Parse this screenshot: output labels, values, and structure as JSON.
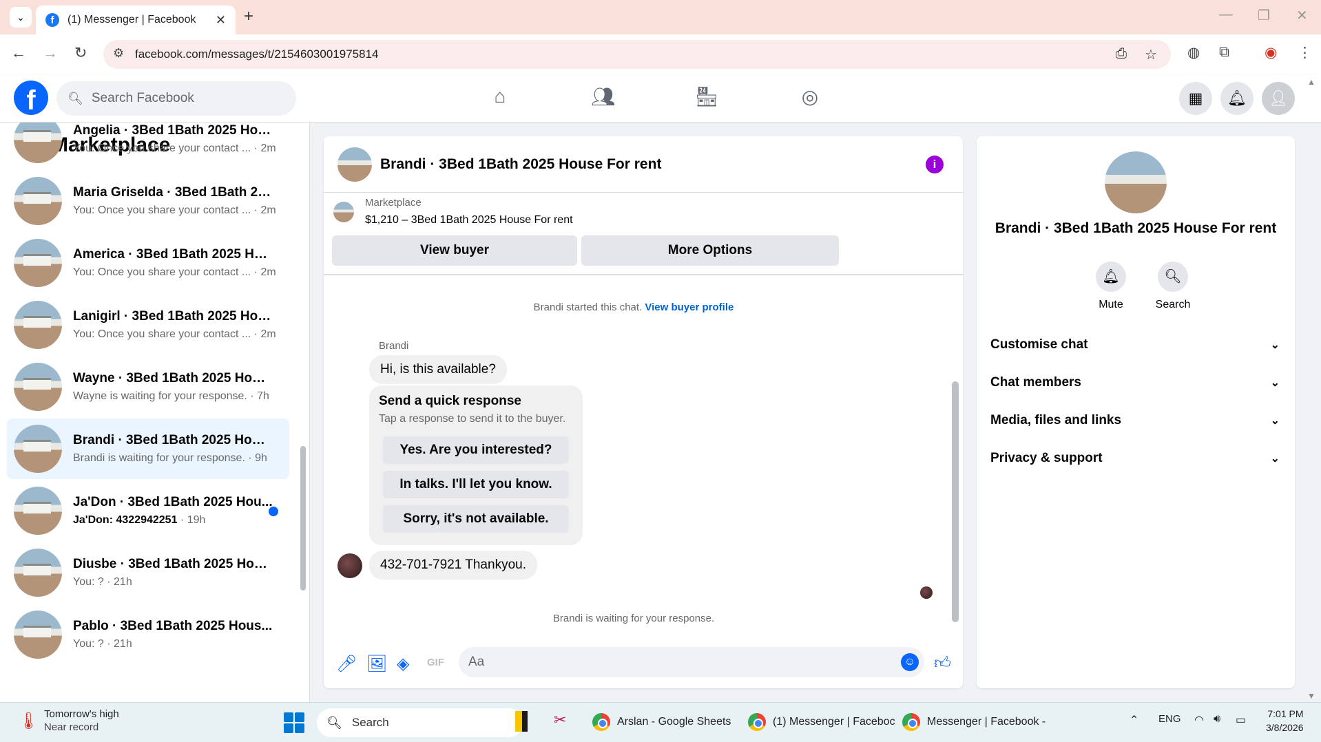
{
  "browser": {
    "tab_title": "(1) Messenger | Facebook",
    "url": "facebook.com/messages/t/2154603001975814"
  },
  "fb_header": {
    "search_placeholder": "Search Facebook"
  },
  "sidebar": {
    "title": "Marketplace",
    "conversations": [
      {
        "name": "Angelia · 3Bed 1Bath 2025 Hous...",
        "preview": "You: Once you share your contact ...",
        "time": "2m",
        "active": false
      },
      {
        "name": "Maria Griselda · 3Bed 1Bath 202...",
        "preview": "You: Once you share your contact ...",
        "time": "2m",
        "active": false
      },
      {
        "name": "America · 3Bed 1Bath 2025 Hous...",
        "preview": "You: Once you share your contact ...",
        "time": "2m",
        "active": false
      },
      {
        "name": "Lanigirl · 3Bed 1Bath 2025 Hous...",
        "preview": "You: Once you share your contact ...",
        "time": "2m",
        "active": false
      },
      {
        "name": "Wayne · 3Bed 1Bath 2025 House...",
        "preview": "Wayne is waiting for your response.",
        "time": "7h",
        "active": false
      },
      {
        "name": "Brandi · 3Bed 1Bath 2025 House ...",
        "preview": "Brandi is waiting for your response.",
        "time": "9h",
        "active": true
      },
      {
        "name": "Ja'Don · 3Bed 1Bath 2025 Hou...",
        "preview": "Ja'Don: 4322942251",
        "time": "19h",
        "active": false,
        "unread": true
      },
      {
        "name": "Diusbe · 3Bed 1Bath 2025 House...",
        "preview": "You: ?",
        "time": "21h",
        "active": false
      },
      {
        "name": "Pablo · 3Bed 1Bath 2025 Hous...",
        "preview": "You: ?",
        "time": "21h",
        "active": false
      }
    ]
  },
  "chat": {
    "title": "Brandi · 3Bed 1Bath 2025 House For rent",
    "marketplace_label": "Marketplace",
    "listing": "$1,210 – 3Bed 1Bath 2025 House For rent",
    "view_buyer": "View buyer",
    "more_options": "More Options",
    "started_text": "Brandi started this chat.",
    "view_buyer_profile": "View buyer profile",
    "sender_name": "Brandi",
    "msg1": "Hi, is this available?",
    "quick_response_title": "Send a quick response",
    "quick_response_sub": "Tap a response to send it to the buyer.",
    "quick_responses": [
      "Yes. Are you interested?",
      "In talks. I'll let you know.",
      "Sorry, it's not available."
    ],
    "msg2": "432-701-7921 Thankyou.",
    "waiting_text": "Brandi is waiting for your response.",
    "composer_placeholder": "Aa"
  },
  "info_panel": {
    "name": "Brandi · 3Bed 1Bath 2025 House For rent",
    "mute": "Mute",
    "search": "Search",
    "sections": [
      "Customise chat",
      "Chat members",
      "Media, files and links",
      "Privacy & support"
    ]
  },
  "taskbar": {
    "weather_title": "Tomorrow's high",
    "weather_sub": "Near record",
    "search_label": "Search",
    "app1": "Arslan - Google Sheets",
    "app2": "(1) Messenger | Faceboc",
    "app3": "Messenger | Facebook -",
    "lang": "ENG",
    "time": "7:01 PM",
    "date": "3/8/2026"
  },
  "colors": {
    "fb_blue": "#0866ff",
    "active_conv": "#ebf5ff",
    "info_purple": "#9b00d9"
  }
}
